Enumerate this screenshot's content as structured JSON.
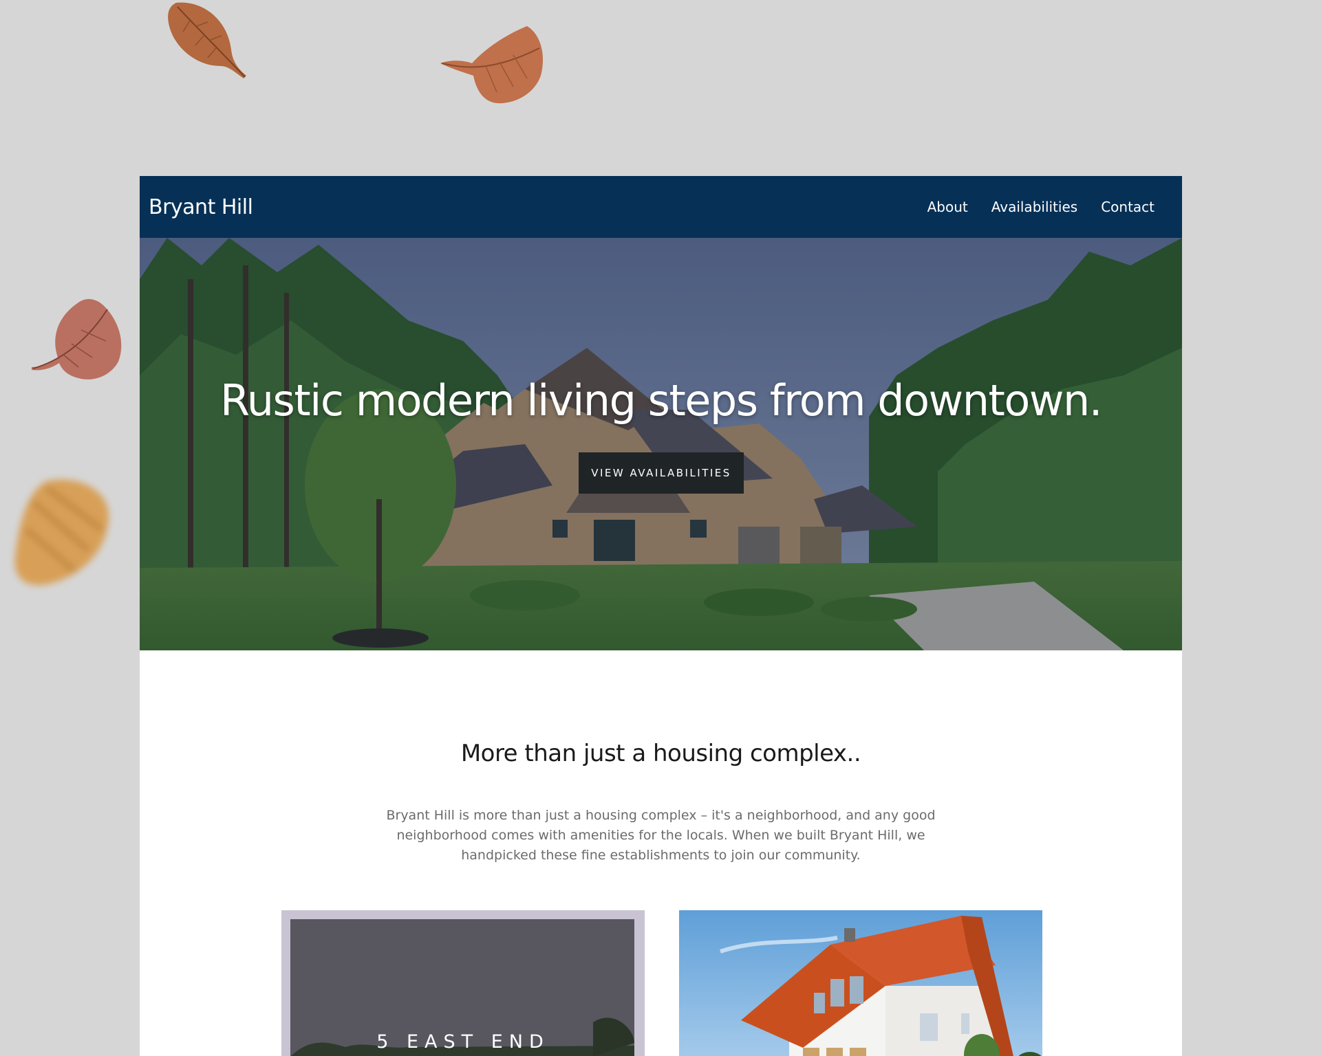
{
  "brand": {
    "name": "Bryant Hill"
  },
  "nav": {
    "items": [
      {
        "label": "About"
      },
      {
        "label": "Availabilities"
      },
      {
        "label": "Contact"
      }
    ]
  },
  "hero": {
    "title": "Rustic modern living steps from downtown.",
    "button_label": "VIEW AVAILABILITIES"
  },
  "intro": {
    "title": "More than just a housing complex..",
    "text": "Bryant Hill is more than just a housing complex – it's a neighborhood, and any good neighborhood comes with amenities for the locals. When we built Bryant Hill, we handpicked these fine establishments to join our community."
  },
  "cards": [
    {
      "label": "5 EAST END"
    },
    {
      "label": ""
    }
  ],
  "colors": {
    "page_background": "#d6d6d6",
    "navbar": "#063056",
    "button": "#1f2426",
    "body_text": "#6b6b6b"
  }
}
